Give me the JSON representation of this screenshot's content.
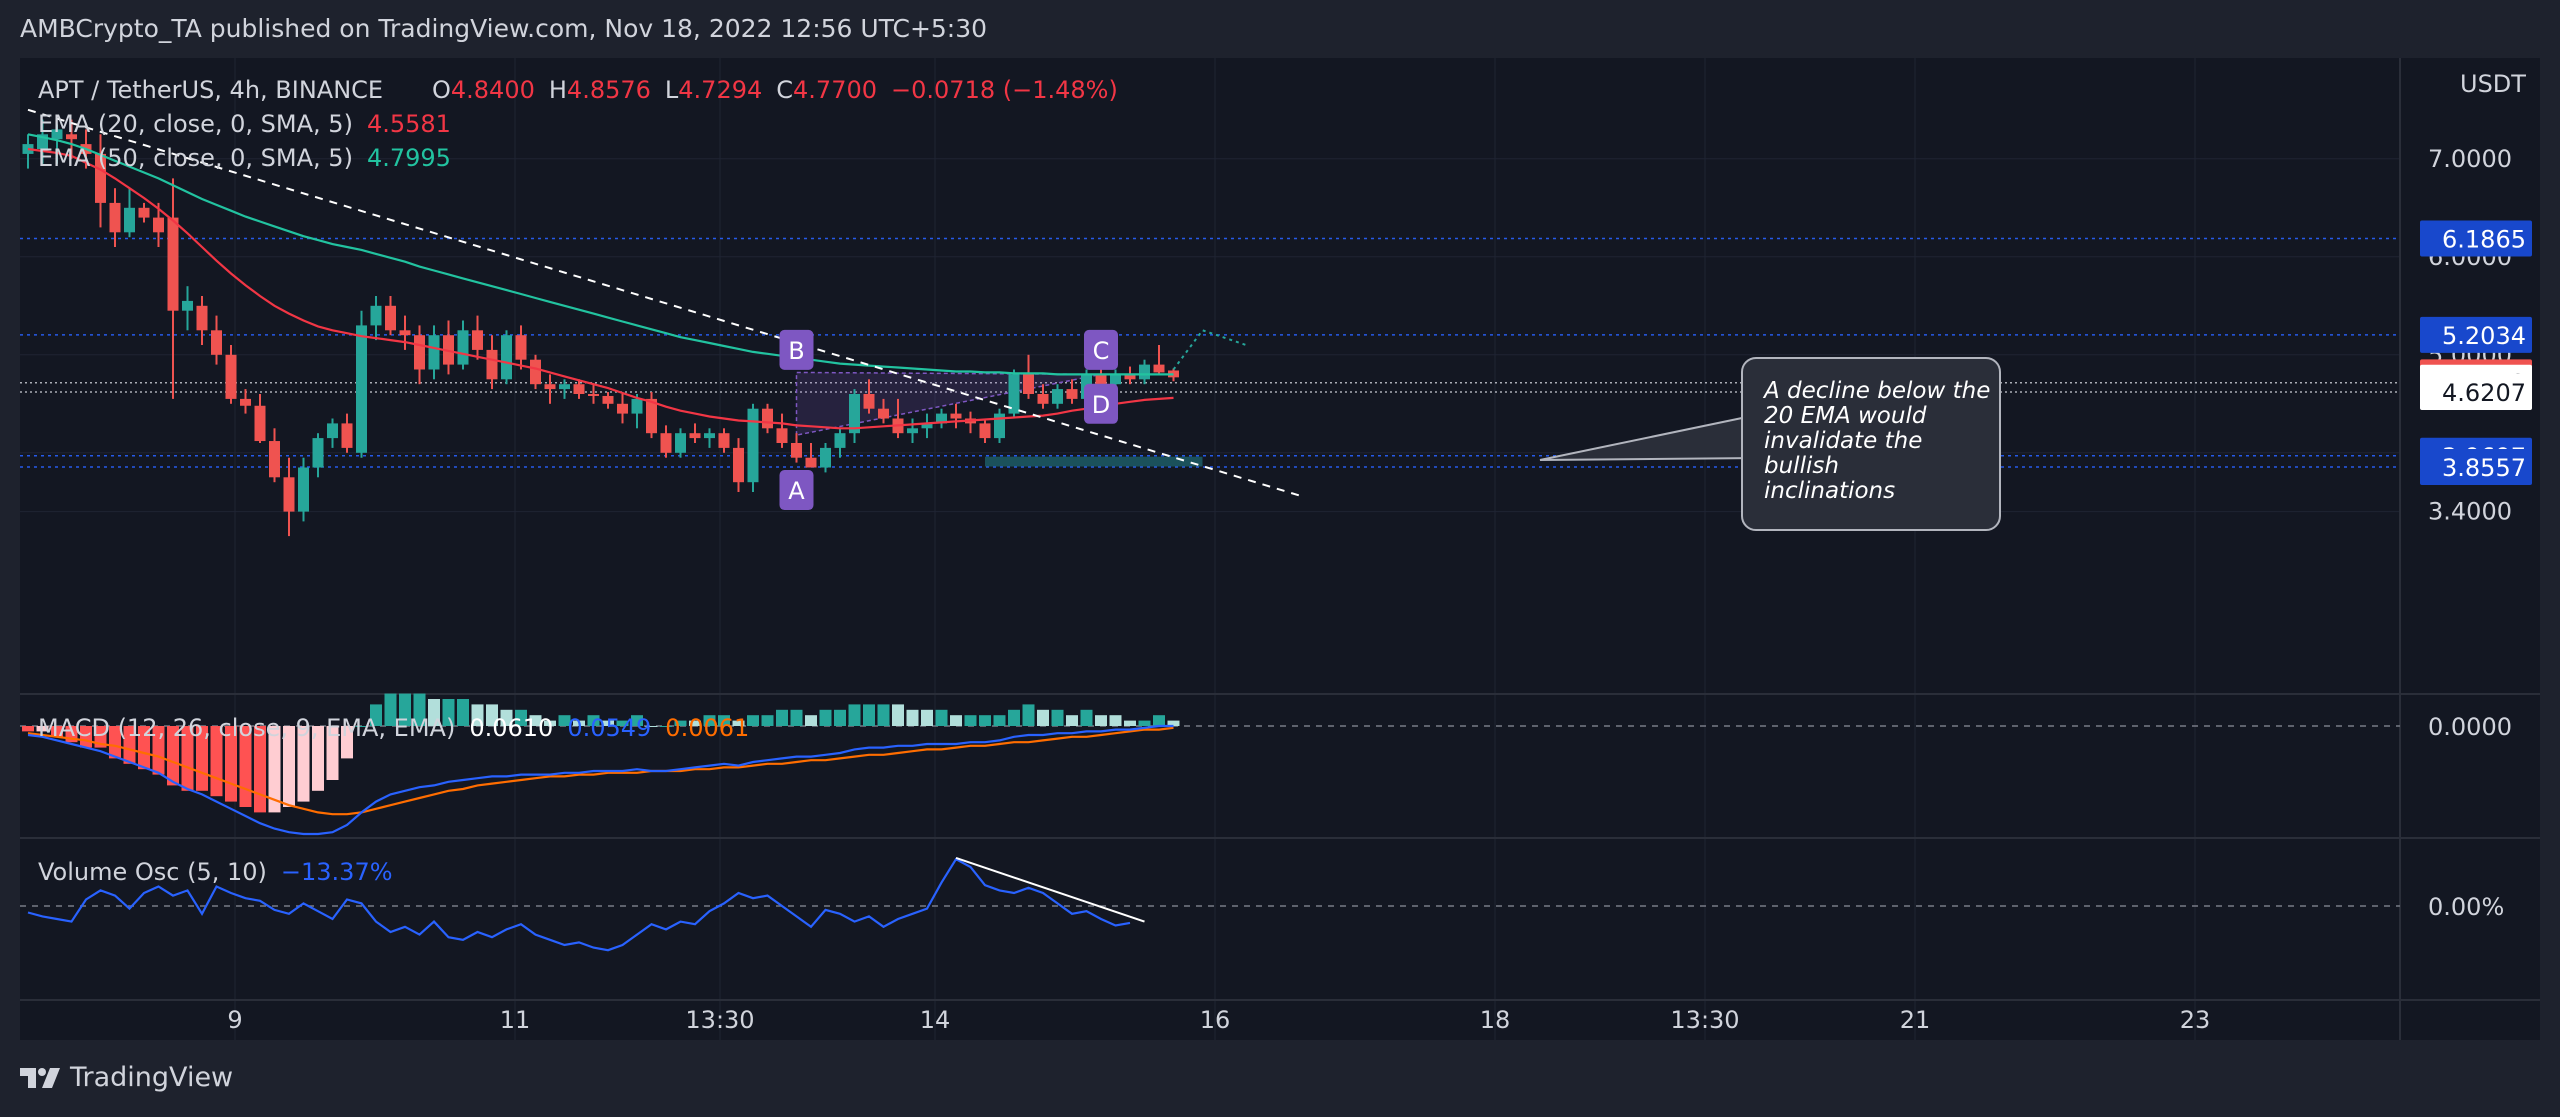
{
  "header": {
    "published_by": "AMBCrypto_TA published on TradingView.com, Nov 18, 2022 12:56 UTC+5:30"
  },
  "footer": {
    "brand": "TradingView"
  },
  "colors": {
    "background": "#131722",
    "up": "#26a69a",
    "down": "#ef5350",
    "ema20": "#f23645",
    "ema50": "#22c3a0",
    "macd": "#2962ff",
    "signal": "#ff6d00",
    "level": "#2962ff",
    "pattern": "#7e57c2"
  },
  "chart_data": [
    {
      "type": "candlestick",
      "symbol_line": {
        "symbol": "APT / TetherUS, 4h, BINANCE",
        "o_label": "O",
        "o": "4.8400",
        "h_label": "H",
        "h": "4.8576",
        "l_label": "L",
        "l": "4.7294",
        "c_label": "C",
        "c": "4.7700",
        "change": "−0.0718 (−1.48%)"
      },
      "indicators": [
        {
          "label": "EMA (20, close, 0, SMA, 5)",
          "value": "4.5581"
        },
        {
          "label": "EMA (50, close, 0, SMA, 5)",
          "value": "4.7995"
        }
      ],
      "currency": "USDT",
      "x_ticks": [
        "9",
        "11",
        "13:30",
        "14",
        "16",
        "18",
        "13:30",
        "21",
        "23"
      ],
      "y_ticks": [
        "7.0000",
        "6.0000",
        "5.0000",
        "3.4000"
      ],
      "price_labels": [
        "6.1865",
        "5.2034",
        "4.7700",
        "4.7153",
        "4.6207",
        "3.9697",
        "3.8557"
      ],
      "horizontal_levels": [
        6.1865,
        5.2034,
        4.7153,
        4.6207,
        3.9697,
        3.8557
      ],
      "ohlc": [
        [
          7.05,
          7.25,
          6.9,
          7.15
        ],
        [
          7.1,
          7.4,
          6.95,
          7.25
        ],
        [
          7.2,
          7.35,
          6.95,
          7.3
        ],
        [
          7.25,
          7.4,
          7.0,
          7.2
        ],
        [
          7.15,
          7.3,
          6.9,
          7.05
        ],
        [
          7.05,
          7.25,
          6.3,
          6.55
        ],
        [
          6.55,
          6.7,
          6.1,
          6.25
        ],
        [
          6.25,
          6.7,
          6.2,
          6.5
        ],
        [
          6.5,
          6.55,
          6.35,
          6.4
        ],
        [
          6.4,
          6.55,
          6.1,
          6.25
        ],
        [
          6.4,
          6.8,
          4.55,
          5.45
        ],
        [
          5.45,
          5.7,
          5.25,
          5.55
        ],
        [
          5.5,
          5.6,
          5.1,
          5.25
        ],
        [
          5.25,
          5.4,
          4.9,
          5.0
        ],
        [
          5.0,
          5.1,
          4.5,
          4.55
        ],
        [
          4.55,
          4.65,
          4.4,
          4.48
        ],
        [
          4.48,
          4.6,
          4.1,
          4.12
        ],
        [
          4.12,
          4.25,
          3.7,
          3.75
        ],
        [
          3.75,
          3.95,
          3.15,
          3.4
        ],
        [
          3.4,
          3.95,
          3.3,
          3.85
        ],
        [
          3.85,
          4.2,
          3.75,
          4.15
        ],
        [
          4.15,
          4.35,
          4.05,
          4.3
        ],
        [
          4.3,
          4.4,
          4.0,
          4.05
        ],
        [
          4.0,
          5.45,
          3.95,
          5.3
        ],
        [
          5.3,
          5.6,
          5.15,
          5.5
        ],
        [
          5.5,
          5.6,
          5.2,
          5.25
        ],
        [
          5.25,
          5.4,
          5.05,
          5.2
        ],
        [
          5.2,
          5.3,
          4.7,
          4.85
        ],
        [
          4.85,
          5.3,
          4.75,
          5.2
        ],
        [
          5.2,
          5.35,
          4.8,
          4.9
        ],
        [
          4.9,
          5.35,
          4.85,
          5.25
        ],
        [
          5.25,
          5.4,
          4.95,
          5.05
        ],
        [
          5.05,
          5.2,
          4.65,
          4.75
        ],
        [
          4.75,
          5.25,
          4.7,
          5.2
        ],
        [
          5.2,
          5.3,
          4.85,
          4.95
        ],
        [
          4.95,
          5.0,
          4.65,
          4.7
        ],
        [
          4.7,
          4.8,
          4.5,
          4.65
        ],
        [
          4.65,
          4.75,
          4.55,
          4.7
        ],
        [
          4.7,
          4.75,
          4.55,
          4.6
        ],
        [
          4.6,
          4.7,
          4.5,
          4.58
        ],
        [
          4.58,
          4.62,
          4.45,
          4.5
        ],
        [
          4.5,
          4.6,
          4.3,
          4.4
        ],
        [
          4.4,
          4.6,
          4.25,
          4.55
        ],
        [
          4.55,
          4.62,
          4.15,
          4.2
        ],
        [
          4.2,
          4.28,
          3.95,
          4.0
        ],
        [
          4.0,
          4.25,
          3.95,
          4.2
        ],
        [
          4.2,
          4.3,
          4.1,
          4.15
        ],
        [
          4.15,
          4.25,
          4.05,
          4.2
        ],
        [
          4.2,
          4.25,
          4.0,
          4.05
        ],
        [
          4.05,
          4.15,
          3.6,
          3.7
        ],
        [
          3.7,
          4.5,
          3.6,
          4.45
        ],
        [
          4.45,
          4.5,
          4.2,
          4.25
        ],
        [
          4.25,
          4.4,
          4.05,
          4.1
        ],
        [
          4.1,
          4.2,
          3.9,
          3.95
        ],
        [
          3.95,
          4.1,
          3.85,
          3.85
        ],
        [
          3.85,
          4.1,
          3.8,
          4.05
        ],
        [
          4.05,
          4.25,
          3.95,
          4.2
        ],
        [
          4.2,
          4.65,
          4.1,
          4.6
        ],
        [
          4.6,
          4.75,
          4.4,
          4.45
        ],
        [
          4.45,
          4.55,
          4.3,
          4.35
        ],
        [
          4.35,
          4.55,
          4.15,
          4.2
        ],
        [
          4.2,
          4.35,
          4.1,
          4.25
        ],
        [
          4.25,
          4.4,
          4.15,
          4.3
        ],
        [
          4.3,
          4.45,
          4.25,
          4.4
        ],
        [
          4.4,
          4.5,
          4.25,
          4.35
        ],
        [
          4.35,
          4.42,
          4.2,
          4.3
        ],
        [
          4.3,
          4.35,
          4.1,
          4.15
        ],
        [
          4.15,
          4.45,
          4.1,
          4.4
        ],
        [
          4.4,
          4.85,
          4.35,
          4.8
        ],
        [
          4.8,
          5.0,
          4.55,
          4.6
        ],
        [
          4.6,
          4.7,
          4.45,
          4.5
        ],
        [
          4.5,
          4.7,
          4.45,
          4.65
        ],
        [
          4.65,
          4.75,
          4.5,
          4.55
        ],
        [
          4.55,
          4.85,
          4.5,
          4.8
        ],
        [
          4.8,
          4.9,
          4.65,
          4.7
        ],
        [
          4.7,
          4.85,
          4.6,
          4.8
        ],
        [
          4.8,
          4.88,
          4.7,
          4.75
        ],
        [
          4.75,
          4.95,
          4.7,
          4.9
        ],
        [
          4.9,
          5.1,
          4.8,
          4.82
        ],
        [
          4.84,
          4.86,
          4.73,
          4.77
        ]
      ],
      "ema20": [
        7.1,
        7.08,
        7.06,
        7.03,
        6.96,
        6.89,
        6.8,
        6.7,
        6.6,
        6.49,
        6.37,
        6.24,
        6.1,
        5.96,
        5.83,
        5.71,
        5.6,
        5.5,
        5.42,
        5.35,
        5.29,
        5.25,
        5.22,
        5.19,
        5.17,
        5.15,
        5.13,
        5.1,
        5.07,
        5.04,
        5.01,
        4.98,
        4.95,
        4.92,
        4.89,
        4.86,
        4.82,
        4.78,
        4.74,
        4.7,
        4.66,
        4.61,
        4.56,
        4.52,
        4.47,
        4.43,
        4.4,
        4.37,
        4.35,
        4.33,
        4.32,
        4.31,
        4.3,
        4.28,
        4.27,
        4.26,
        4.25,
        4.25,
        4.26,
        4.27,
        4.28,
        4.29,
        4.3,
        4.31,
        4.32,
        4.33,
        4.34,
        4.35,
        4.36,
        4.37,
        4.38,
        4.4,
        4.43,
        4.45,
        4.48,
        4.5,
        4.52,
        4.54,
        4.55,
        4.56
      ],
      "ema50": [
        7.25,
        7.22,
        7.19,
        7.15,
        7.1,
        7.04,
        6.98,
        6.92,
        6.86,
        6.8,
        6.73,
        6.66,
        6.59,
        6.53,
        6.47,
        6.41,
        6.36,
        6.31,
        6.26,
        6.21,
        6.17,
        6.13,
        6.1,
        6.07,
        6.03,
        5.99,
        5.95,
        5.9,
        5.86,
        5.82,
        5.78,
        5.74,
        5.7,
        5.66,
        5.62,
        5.58,
        5.54,
        5.5,
        5.46,
        5.42,
        5.38,
        5.34,
        5.3,
        5.26,
        5.22,
        5.18,
        5.15,
        5.12,
        5.09,
        5.06,
        5.03,
        5.01,
        4.99,
        4.97,
        4.95,
        4.93,
        4.91,
        4.9,
        4.89,
        4.88,
        4.87,
        4.86,
        4.85,
        4.84,
        4.83,
        4.83,
        4.82,
        4.82,
        4.81,
        4.81,
        4.81,
        4.8,
        4.8,
        4.8,
        4.8,
        4.8,
        4.8,
        4.8,
        4.8,
        4.8
      ],
      "trendline": {
        "from": [
          0,
          7.5
        ],
        "to": [
          88,
          3.55
        ],
        "style": "dashed",
        "color": "#ffffff"
      },
      "pattern_labels": [
        "A",
        "B",
        "C",
        "D"
      ],
      "triangle": {
        "points": [
          [
            53,
            4.18
          ],
          [
            53,
            4.82
          ],
          [
            74,
            4.8
          ]
        ]
      },
      "target_zone": {
        "x0": 66,
        "x1": 81,
        "low": 3.86,
        "high": 3.96
      },
      "annotation": "A decline below the 20 EMA would invalidate the bullish inclinations"
    },
    {
      "type": "macd",
      "label": "MACD (12, 26, close, 9, EMA, EMA)",
      "values": [
        "0.0610",
        "0.0549",
        "0.0061"
      ],
      "y_ticks": [
        "0.0000"
      ],
      "macd": [
        -0.05,
        -0.06,
        -0.08,
        -0.1,
        -0.12,
        -0.14,
        -0.17,
        -0.2,
        -0.23,
        -0.26,
        -0.31,
        -0.35,
        -0.38,
        -0.42,
        -0.46,
        -0.5,
        -0.54,
        -0.57,
        -0.59,
        -0.6,
        -0.6,
        -0.59,
        -0.55,
        -0.48,
        -0.42,
        -0.38,
        -0.36,
        -0.34,
        -0.33,
        -0.31,
        -0.3,
        -0.29,
        -0.28,
        -0.28,
        -0.27,
        -0.27,
        -0.27,
        -0.26,
        -0.26,
        -0.25,
        -0.25,
        -0.25,
        -0.24,
        -0.25,
        -0.25,
        -0.24,
        -0.23,
        -0.22,
        -0.21,
        -0.22,
        -0.2,
        -0.19,
        -0.18,
        -0.17,
        -0.17,
        -0.16,
        -0.15,
        -0.13,
        -0.12,
        -0.12,
        -0.11,
        -0.11,
        -0.1,
        -0.1,
        -0.1,
        -0.09,
        -0.09,
        -0.08,
        -0.06,
        -0.05,
        -0.05,
        -0.04,
        -0.04,
        -0.03,
        -0.03,
        -0.02,
        -0.02,
        -0.01,
        0.0,
        0.0
      ],
      "signal": [
        -0.04,
        -0.05,
        -0.06,
        -0.07,
        -0.08,
        -0.1,
        -0.11,
        -0.13,
        -0.15,
        -0.17,
        -0.2,
        -0.23,
        -0.26,
        -0.29,
        -0.32,
        -0.35,
        -0.38,
        -0.41,
        -0.44,
        -0.46,
        -0.48,
        -0.49,
        -0.49,
        -0.48,
        -0.46,
        -0.44,
        -0.42,
        -0.4,
        -0.38,
        -0.36,
        -0.35,
        -0.33,
        -0.32,
        -0.31,
        -0.3,
        -0.29,
        -0.28,
        -0.28,
        -0.27,
        -0.27,
        -0.26,
        -0.26,
        -0.26,
        -0.25,
        -0.25,
        -0.25,
        -0.24,
        -0.24,
        -0.23,
        -0.23,
        -0.22,
        -0.21,
        -0.21,
        -0.2,
        -0.19,
        -0.19,
        -0.18,
        -0.17,
        -0.16,
        -0.16,
        -0.15,
        -0.14,
        -0.13,
        -0.13,
        -0.12,
        -0.11,
        -0.11,
        -0.1,
        -0.09,
        -0.09,
        -0.08,
        -0.07,
        -0.06,
        -0.06,
        -0.05,
        -0.04,
        -0.03,
        -0.02,
        -0.02,
        -0.01
      ]
    },
    {
      "type": "line",
      "label": "Volume Osc (5, 10)",
      "value": "−13.37%",
      "y_ticks": [
        "0.00%"
      ],
      "values": [
        -5,
        -8,
        -10,
        -12,
        5,
        12,
        8,
        -2,
        10,
        15,
        8,
        12,
        -6,
        15,
        10,
        6,
        4,
        -3,
        -6,
        2,
        -4,
        -10,
        5,
        2,
        -12,
        -20,
        -16,
        -22,
        -12,
        -24,
        -26,
        -20,
        -24,
        -18,
        -14,
        -22,
        -26,
        -30,
        -28,
        -32,
        -34,
        -30,
        -22,
        -14,
        -18,
        -12,
        -14,
        -4,
        2,
        10,
        6,
        8,
        0,
        -8,
        -16,
        -3,
        -6,
        -12,
        -8,
        -16,
        -10,
        -6,
        -2,
        18,
        36,
        30,
        16,
        12,
        10,
        14,
        10,
        2,
        -6,
        -4,
        -10,
        -15,
        -13
      ],
      "trendline": {
        "from": [
          64,
          37
        ],
        "to": [
          77,
          -12
        ]
      }
    }
  ]
}
